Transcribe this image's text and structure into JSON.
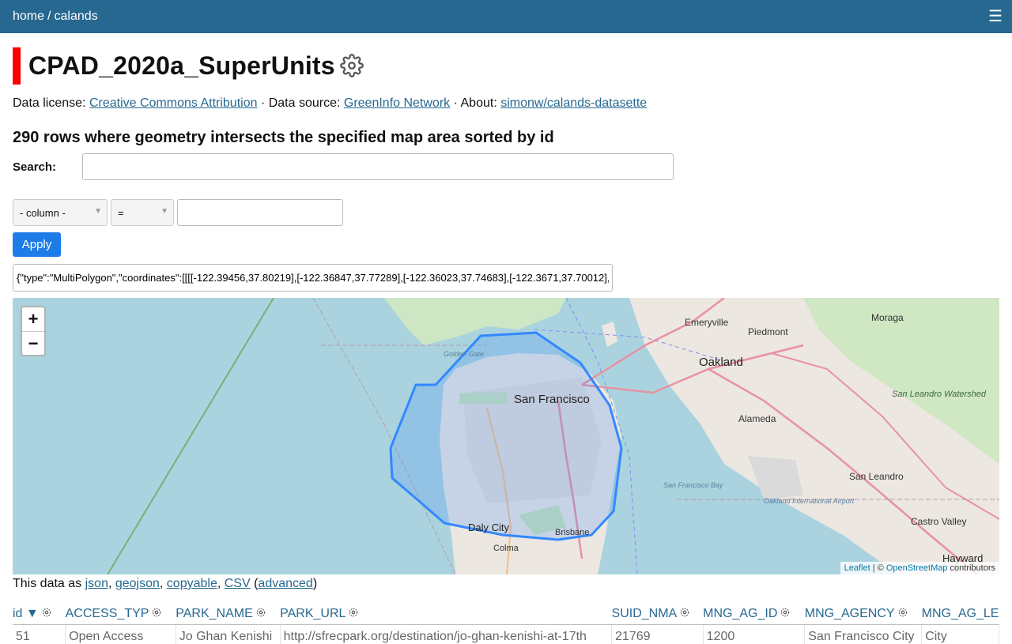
{
  "header": {
    "crumb_home": "home",
    "crumb_sep": "/",
    "crumb_db": "calands"
  },
  "title": "CPAD_2020a_SuperUnits",
  "meta": {
    "license_label": "Data license:",
    "license_link": "Creative Commons Attribution",
    "source_label": "· Data source:",
    "source_link": "GreenInfo Network",
    "about_label": "· About:",
    "about_link": "simonw/calands-datasette"
  },
  "count_text": "290 rows where geometry intersects the specified map area sorted by id",
  "search": {
    "label": "Search:",
    "value": ""
  },
  "filter": {
    "column_select": "- column -",
    "op_select": "=",
    "value": ""
  },
  "apply_label": "Apply",
  "geometry_value": "{\"type\":\"MultiPolygon\",\"coordinates\":[[[[-122.39456,37.80219],[-122.36847,37.77289],[-122.36023,37.74683],[-122.3671,37.70012],[-122.",
  "map": {
    "zoom_in": "+",
    "zoom_out": "−",
    "labels": {
      "emeryville": "Emeryville",
      "piedmont": "Piedmont",
      "moraga": "Moraga",
      "oakland": "Oakland",
      "alameda": "Alameda",
      "san_francisco": "San Francisco",
      "golden_gate": "Golden Gate",
      "san_leandro_watershed": "San Leandro Watershed",
      "san_leandro": "San Leandro",
      "oakland_airport": "Oakland International Airport",
      "sf_bay": "San Francisco Bay",
      "daly_city": "Daly City",
      "colma": "Colma",
      "brisbane": "Brisbane",
      "castro_valley": "Castro Valley",
      "hayward": "Hayward"
    },
    "attribution_leaflet": "Leaflet",
    "attribution_sep": " | © ",
    "attribution_osm": "OpenStreetMap",
    "attribution_tail": " contributors"
  },
  "data_as": {
    "prefix": "This data as",
    "json": "json",
    "geojson": "geojson",
    "copyable": "copyable",
    "csv": "CSV",
    "advanced": "advanced"
  },
  "table": {
    "columns": [
      "id ▼",
      "ACCESS_TYP",
      "PARK_NAME",
      "PARK_URL",
      "SUID_NMA",
      "MNG_AG_ID",
      "MNG_AGENCY",
      "MNG_AG_LE"
    ],
    "first_row": [
      "51",
      "Open Access",
      "Jo Ghan Kenishi",
      "http://sfrecpark.org/destination/jo-ghan-kenishi-at-17th",
      "21769",
      "1200",
      "San Francisco City",
      "City"
    ]
  }
}
